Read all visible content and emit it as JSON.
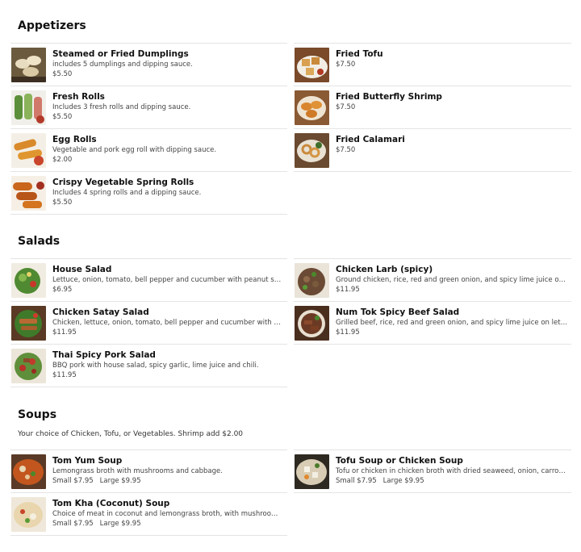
{
  "sections": {
    "appetizers": {
      "title": "Appetizers",
      "left": [
        {
          "name": "Steamed or Fried Dumplings",
          "desc": "includes 5 dumplings and dipping sauce.",
          "price": "$5.50",
          "icon": "dumplings-photo"
        },
        {
          "name": "Fresh Rolls",
          "desc": "Includes 3 fresh rolls and dipping sauce.",
          "price": "$5.50",
          "icon": "fresh-rolls-photo"
        },
        {
          "name": "Egg Rolls",
          "desc": "Vegetable and pork egg roll with dipping sauce.",
          "price": "$2.00",
          "icon": "egg-rolls-photo"
        },
        {
          "name": "Crispy Vegetable Spring Rolls",
          "desc": "Includes 4 spring rolls and a dipping sauce.",
          "price": "$5.50",
          "icon": "spring-rolls-photo"
        }
      ],
      "right": [
        {
          "name": "Fried Tofu",
          "price": "$7.50",
          "icon": "fried-tofu-photo"
        },
        {
          "name": "Fried Butterfly Shrimp",
          "price": "$7.50",
          "icon": "butterfly-shrimp-photo"
        },
        {
          "name": "Fried Calamari",
          "price": "$7.50",
          "icon": "calamari-photo"
        }
      ]
    },
    "salads": {
      "title": "Salads",
      "left": [
        {
          "name": "House Salad",
          "desc": "Lettuce, onion, tomato, bell pepper and cucumber with peanut sau...",
          "price": "$6.95",
          "icon": "house-salad-photo"
        },
        {
          "name": "Chicken Satay Salad",
          "desc": "Chicken, lettuce, onion, tomato, bell pepper and cucumber with pe...",
          "price": "$11.95",
          "icon": "chicken-satay-salad-photo"
        },
        {
          "name": "Thai Spicy Pork Salad",
          "desc": "BBQ pork with house salad, spicy garlic, lime juice and chili.",
          "price": "$11.95",
          "icon": "pork-salad-photo"
        }
      ],
      "right": [
        {
          "name": "Chicken Larb (spicy)",
          "desc": "Ground chicken, rice, red and green onion, and spicy lime juice on l...",
          "price": "$11.95",
          "icon": "chicken-larb-photo"
        },
        {
          "name": "Num Tok Spicy Beef Salad",
          "desc": "Grilled beef, rice, red and green onion, and spicy lime juice on lettu...",
          "price": "$11.95",
          "icon": "beef-salad-photo"
        }
      ]
    },
    "soups": {
      "title": "Soups",
      "note": "Your choice of Chicken, Tofu, or Vegetables. Shrimp add $2.00",
      "left": [
        {
          "name": "Tom Yum Soup",
          "desc": "Lemongrass broth with mushrooms and cabbage.",
          "price_small": "Small $7.95",
          "price_large": "Large $9.95",
          "icon": "tom-yum-photo"
        },
        {
          "name": "Tom Kha (Coconut) Soup",
          "desc": "Choice of meat in coconut and lemongrass broth, with mushrooms ...",
          "price_small": "Small $7.95",
          "price_large": "Large $9.95",
          "icon": "tom-kha-photo"
        }
      ],
      "right": [
        {
          "name": "Tofu Soup or Chicken Soup",
          "desc": "Tofu or chicken in chicken broth with dried seaweed, onion, carrot,...",
          "price_small": "Small $7.95",
          "price_large": "Large $9.95",
          "icon": "tofu-soup-photo"
        }
      ]
    }
  },
  "colors": {
    "divider": "#e4e4e4",
    "title": "#111111",
    "text": "#444444"
  }
}
